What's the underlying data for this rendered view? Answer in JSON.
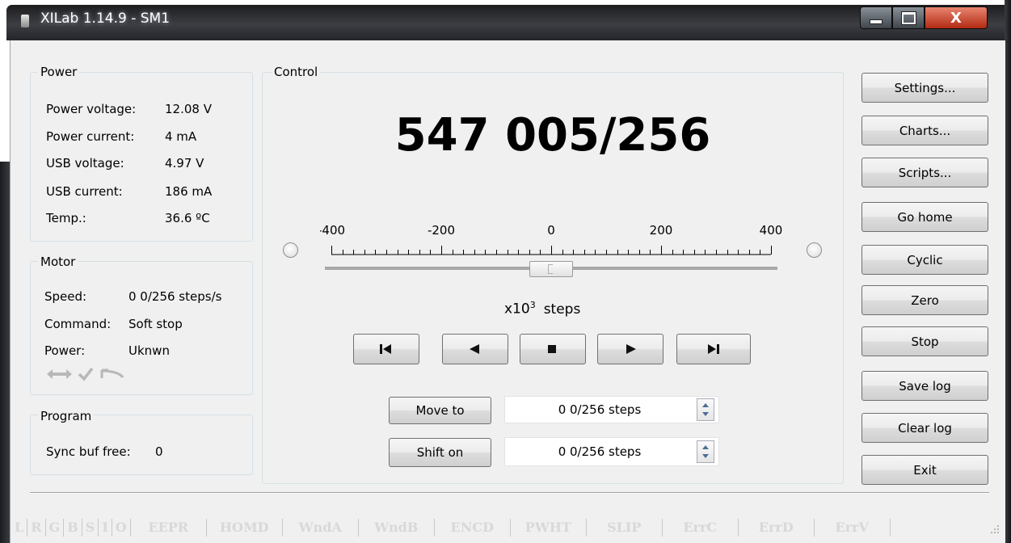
{
  "window": {
    "title": "XILab 1.14.9 - SM1",
    "close_glyph": "X"
  },
  "power": {
    "title": "Power",
    "rows": [
      {
        "label": "Power voltage:",
        "value": "12.08 V"
      },
      {
        "label": "Power current:",
        "value": "4 mA"
      },
      {
        "label": "USB voltage:",
        "value": "4.97 V"
      },
      {
        "label": "USB current:",
        "value": "186 mA"
      },
      {
        "label": "Temp.:",
        "value": "36.6 ºC"
      }
    ]
  },
  "motor": {
    "title": "Motor",
    "rows": [
      {
        "label": "Speed:",
        "value": "0 0/256 steps/s"
      },
      {
        "label": "Command:",
        "value": "Soft stop"
      },
      {
        "label": "Power:",
        "value": "Uknwn"
      }
    ],
    "icons": [
      "left-right-arrow-icon",
      "checkmark-icon",
      "undo-arrow-icon"
    ]
  },
  "program": {
    "title": "Program",
    "sync_label": "Sync buf free:",
    "sync_value": "0"
  },
  "control": {
    "title": "Control",
    "position": "547 005/256",
    "scale_labels": [
      "-400",
      "-200",
      "0",
      "200",
      "400"
    ],
    "scale_min": -400,
    "scale_max": 400,
    "slider_value": 0,
    "unit_prefix": "x10",
    "unit_exp": "3",
    "unit_suffix": "steps",
    "transport_icons": [
      "skip-to-start-icon",
      "step-left-icon",
      "stop-icon",
      "step-right-icon",
      "skip-to-end-icon"
    ],
    "move_to_label": "Move to",
    "move_to_value": "0 0/256 steps",
    "shift_on_label": "Shift on",
    "shift_on_value": "0 0/256 steps"
  },
  "buttons": [
    "Settings...",
    "Charts...",
    "Scripts...",
    "Go home",
    "Cyclic",
    "Zero",
    "Stop",
    "Save log",
    "Clear log",
    "Exit"
  ],
  "status_flags": [
    "L",
    "R",
    "G",
    "B",
    "S",
    "I",
    "O",
    "EEPR",
    "HOMD",
    "WndA",
    "WndB",
    "ENCD",
    "PWHT",
    "SLIP",
    "ErrC",
    "ErrD",
    "ErrV"
  ]
}
